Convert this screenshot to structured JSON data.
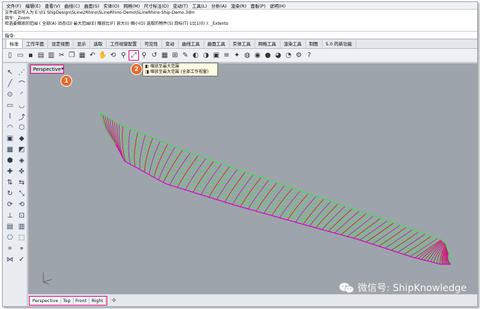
{
  "menu": [
    "文件(F)",
    "编辑(E)",
    "查看(V)",
    "曲线(C)",
    "曲面(S)",
    "实体(O)",
    "网格(M)",
    "尺寸标注(D)",
    "变动(T)",
    "工具(L)",
    "分析(A)",
    "渲染(R)",
    "面板(P)",
    "说明(H)"
  ],
  "command_history": {
    "line1": "文件成功写入为 E:\\01 ShipDesign\\SLine2Rhino\\SLineRhino-Demo\\SLineRhino-Ship-Demo.3dm",
    "line2": "指令: _Zoom",
    "line3": "检选要缩放的范围 ( 全部(A)  动态(D)  最大范围(E)  缩放比(F)  放大(I)  缩小(O)  选取的物件(S)  目标(T)  1比1(0) ):  _Extents"
  },
  "command_prompt": "指令:",
  "toolbar_tabs": [
    "标准",
    "工作平面",
    "设定视图",
    "显示",
    "选取",
    "工作视窗配置",
    "可见性",
    "变动",
    "曲线工具",
    "曲面工具",
    "实体工具",
    "网格工具",
    "渲染工具",
    "制图",
    "5.0 的新功能"
  ],
  "active_tab": "标准",
  "toolbar_icons": [
    "new-file-icon",
    "open-folder-icon",
    "save-icon",
    "print-icon",
    "import-icon",
    "cut-icon",
    "copy-icon",
    "paste-icon",
    "undo-icon",
    "pan-hand-icon",
    "rotate-view-icon",
    "zoom-icon",
    "zoom-extents-icon",
    "zoom-selected-icon",
    "undo-view-icon",
    "grid-icon",
    "four-viewports-icon",
    "properties-icon",
    "hide-icon",
    "show-icon",
    "lock-icon",
    "layer-icon",
    "light-icon",
    "render-icon",
    "material-icon",
    "shaded-sphere-icon",
    "rendered-sphere-icon",
    "color-sphere-icon",
    "options-icon",
    "help-icon"
  ],
  "tooltip": {
    "line1": "缩放至最大范围",
    "line2": "缩放至最大范围 (全部工作视窗)"
  },
  "viewport_title": "Perspective",
  "badges": {
    "first": "1",
    "second": "2"
  },
  "bottom_tabs": [
    "Perspective",
    "Top",
    "Front",
    "Right"
  ],
  "active_bottom_tab": "Perspective",
  "add_tab_symbol": "✛",
  "watermark": "微信号: ShipKnowledge",
  "colors": {
    "highlight": "#e4007f",
    "badge": "#e86a2a",
    "viewport_bg": "#9ea4ab",
    "hull_green": "#39e24a",
    "hull_magenta": "#d000c8",
    "hull_red": "#e8003a"
  }
}
